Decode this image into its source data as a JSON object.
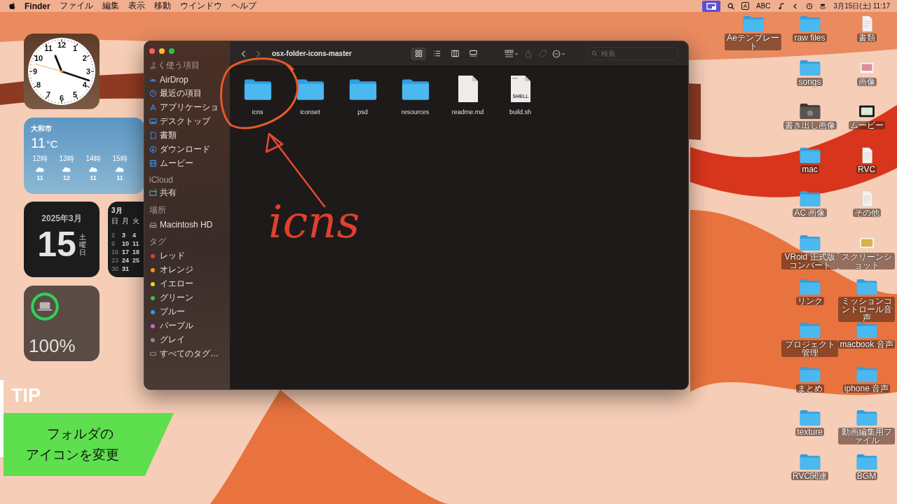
{
  "menu_bar": {
    "app": "Finder",
    "menus": [
      "ファイル",
      "編集",
      "表示",
      "移動",
      "ウインドウ",
      "ヘルプ"
    ],
    "input_source": "A",
    "input_label": "ABC",
    "clock": "3月15日(土) 11:17"
  },
  "widgets": {
    "clock": {
      "numerals": [
        "12",
        "11",
        "1",
        "10",
        "2",
        "9",
        "3",
        "8",
        "4",
        "7",
        "5",
        "6"
      ]
    },
    "weather": {
      "city": "大和市",
      "temperature": "11",
      "unit": "°C",
      "hours": [
        {
          "time": "12時",
          "temp": "11"
        },
        {
          "time": "13時",
          "temp": "12"
        },
        {
          "time": "14時",
          "temp": "11"
        },
        {
          "time": "15時",
          "temp": "11"
        }
      ]
    },
    "date": {
      "month": "2025年3月",
      "day": "15",
      "weekday": "土曜日"
    },
    "calendar": {
      "month": "3月",
      "weekdays": [
        "日",
        "月",
        "火"
      ],
      "weeks": [
        [
          "2",
          "3",
          "4"
        ],
        [
          "9",
          "10",
          "11"
        ],
        [
          "16",
          "17",
          "18"
        ],
        [
          "23",
          "24",
          "25"
        ],
        [
          "30",
          "31"
        ]
      ]
    },
    "battery": {
      "level": 1,
      "reading": "100%"
    }
  },
  "finder": {
    "title": "osx-folder-icons-master",
    "views": [
      {
        "selected": true
      },
      {
        "selected": false
      },
      {
        "selected": false
      },
      {
        "selected": false
      }
    ],
    "search": {
      "placeholder": "検索"
    },
    "sidebar": [
      {
        "heading": "よく使う項目",
        "items": [
          {
            "label": "AirDrop"
          },
          {
            "label": "最近の項目"
          },
          {
            "label": "アプリケーショ"
          },
          {
            "label": "デスクトップ"
          },
          {
            "label": "書類"
          },
          {
            "label": "ダウンロード"
          },
          {
            "label": "ムービー"
          }
        ]
      },
      {
        "heading": "iCloud",
        "items": [
          {
            "label": "共有"
          }
        ]
      },
      {
        "heading": "場所",
        "items": [
          {
            "label": "Macintosh HD"
          }
        ]
      },
      {
        "heading": "タグ",
        "items": [
          {
            "label": "レッド",
            "color": "#e8334a"
          },
          {
            "label": "オレンジ",
            "color": "#f0961e"
          },
          {
            "label": "イエロー",
            "color": "#f2d21b"
          },
          {
            "label": "グリーン",
            "color": "#2fc940"
          },
          {
            "label": "ブルー",
            "color": "#2a9cf0"
          },
          {
            "label": "パープル",
            "color": "#d55ad8"
          },
          {
            "label": "グレイ",
            "color": "#8e8a88"
          },
          {
            "label": "すべてのタグ…"
          }
        ]
      }
    ],
    "files": [
      {
        "name": "icns",
        "kind": "folder"
      },
      {
        "name": "iconset",
        "kind": "folder"
      },
      {
        "name": "psd",
        "kind": "folder"
      },
      {
        "name": "resources",
        "kind": "folder"
      },
      {
        "name": "readme.md",
        "kind": "document"
      },
      {
        "name": "build.sh",
        "kind": "script",
        "badge": "SHELL"
      }
    ],
    "annotation": {
      "text": "icns"
    }
  },
  "desktop_icons": {
    "columns": [
      [
        {
          "name": "Aeテンプレート",
          "kind": "folder"
        }
      ],
      [
        {
          "name": "raw files",
          "kind": "folder"
        },
        {
          "name": "songs",
          "kind": "folder"
        },
        {
          "name": "書き出し画像",
          "kind": "dark-folder"
        },
        {
          "name": "mac",
          "kind": "folder"
        },
        {
          "name": "AC 画像",
          "kind": "folder"
        },
        {
          "name": "VRoid 正式版コンバート",
          "kind": "folder"
        },
        {
          "name": "リンク",
          "kind": "folder"
        },
        {
          "name": "プロジェクト管理",
          "kind": "folder"
        },
        {
          "name": "まとめ",
          "kind": "folder"
        },
        {
          "name": "texture",
          "kind": "folder"
        },
        {
          "name": "RVC関連",
          "kind": "folder"
        }
      ],
      [
        {
          "name": "書類",
          "kind": "document"
        },
        {
          "name": "画像",
          "kind": "image"
        },
        {
          "name": "ムービー",
          "kind": "movie"
        },
        {
          "name": "RVC",
          "kind": "document"
        },
        {
          "name": "その他",
          "kind": "document"
        },
        {
          "name": "スクリーンショット",
          "kind": "photo"
        },
        {
          "name": "ミッションコントロール音声",
          "kind": "folder"
        },
        {
          "name": "macbook 音声",
          "kind": "folder"
        },
        {
          "name": "iphone 音声",
          "kind": "folder"
        },
        {
          "name": "動画編集用ファイル",
          "kind": "folder"
        },
        {
          "name": "BGM",
          "kind": "folder"
        }
      ]
    ]
  },
  "tip": {
    "title": "TIP",
    "caption_lines": [
      "フォルダの",
      "アイコンを変更"
    ]
  }
}
